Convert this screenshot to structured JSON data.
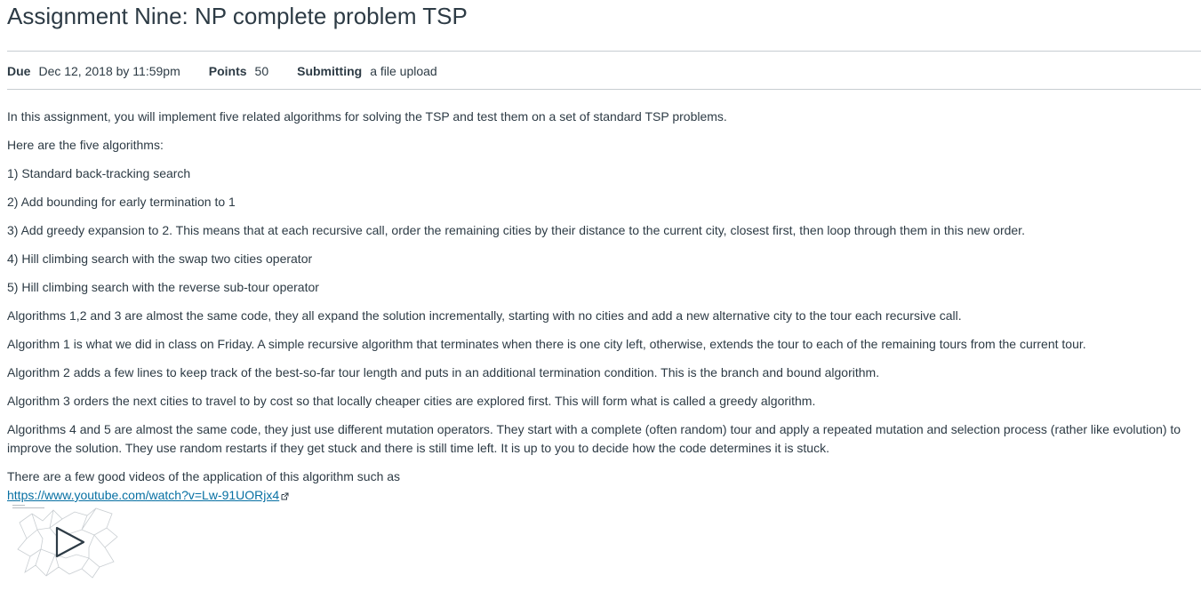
{
  "assignment": {
    "title": "Assignment Nine: NP complete problem TSP"
  },
  "details": {
    "due_label": "Due",
    "due_value": "Dec 12, 2018 by 11:59pm",
    "points_label": "Points",
    "points_value": "50",
    "submitting_label": "Submitting",
    "submitting_value": "a file upload"
  },
  "description": {
    "paragraphs": [
      "In this assignment, you will implement five related algorithms for solving the TSP and test them on a set of standard TSP problems.",
      "Here are the five algorithms:",
      "1) Standard back-tracking search",
      "2) Add bounding for early termination to 1",
      "3) Add greedy expansion to 2. This means that at each recursive call, order the remaining cities by their distance to the current city, closest first, then loop through them in this new order.",
      "4) Hill climbing search with the swap two cities operator",
      "5) Hill climbing search with the reverse sub-tour operator",
      "Algorithms 1,2 and 3 are almost the same code, they all expand the solution incrementally, starting with no cities and add a new alternative city to the tour each recursive call.",
      "Algorithm 1 is what we did in class on Friday. A simple recursive algorithm that terminates when there is one city left, otherwise, extends the tour to each of the remaining tours from the current tour.",
      "Algorithm 2 adds a few lines to keep track of the best-so-far tour length and puts in an additional termination condition. This is the branch and bound algorithm.",
      "Algorithm 3 orders the next cities to travel to by cost so that locally cheaper cities are explored first. This will form what is called a greedy algorithm.",
      "Algorithms 4 and 5 are almost the same code, they just use different mutation operators. They start with a complete (often random) tour and apply a repeated mutation and selection process (rather like evolution) to improve the solution. They use random restarts if they get stuck and there is still time left. It is up to you to decide how the code determines it is stuck.",
      "There are a few good videos of the application of this algorithm such as"
    ],
    "video_link": "https://www.youtube.com/watch?v=Lw-91UORjx4"
  },
  "icons": {
    "external_link": "external-link-icon",
    "play": "play-icon"
  },
  "colors": {
    "text": "#2d3b45",
    "link": "#0770a3",
    "rule": "#c7cdd1"
  }
}
